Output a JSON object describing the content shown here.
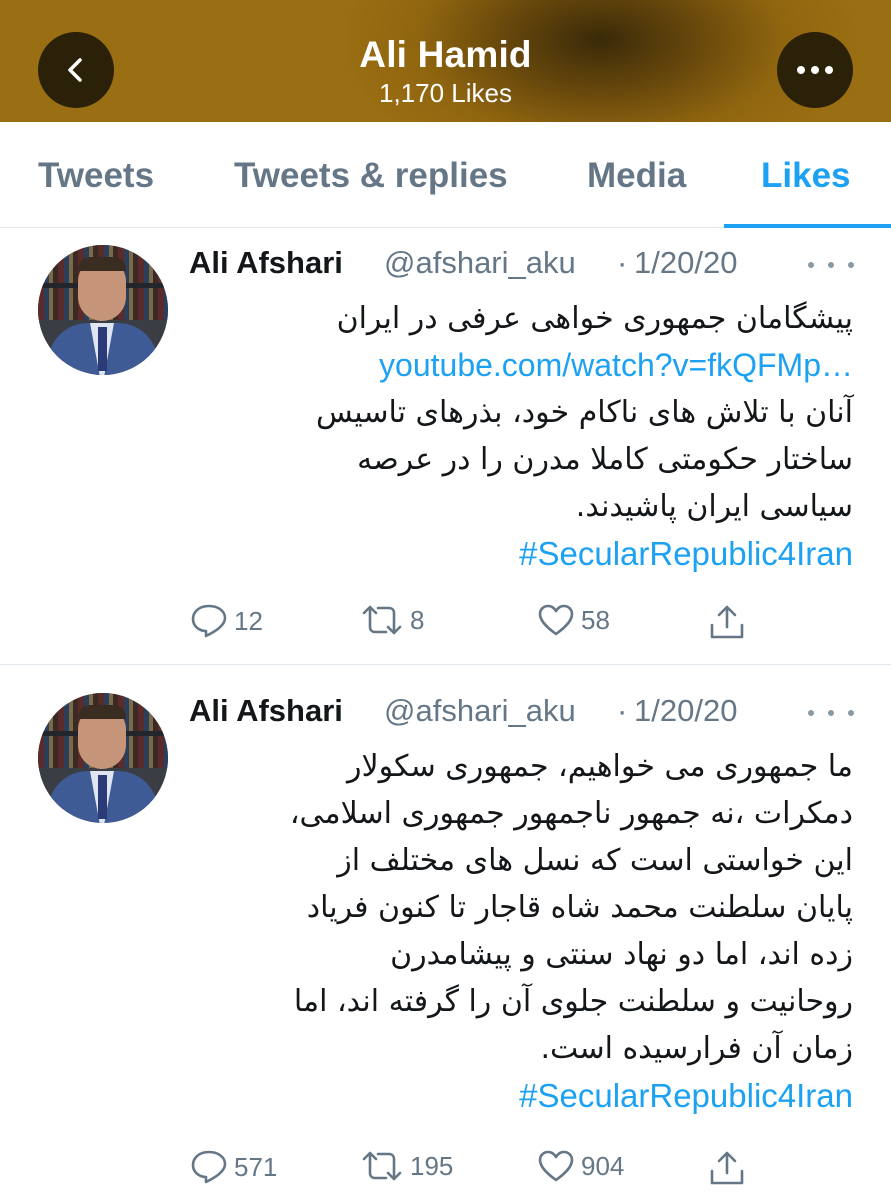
{
  "header": {
    "title": "Ali Hamid",
    "subtitle": "1,170 Likes",
    "bg_color": "#96700f"
  },
  "tabs": [
    {
      "label": "Tweets",
      "active": false
    },
    {
      "label": "Tweets & replies",
      "active": false
    },
    {
      "label": "Media",
      "active": false
    },
    {
      "label": "Likes",
      "active": true
    }
  ],
  "accent_color": "#1da1f2",
  "tweets": [
    {
      "name": "Ali Afshari",
      "handle": "@afshari_aku",
      "sep": "·",
      "date": "1/20/20",
      "lines": [
        "پیشگامان جمهوری خواهی عرفی در ایران"
      ],
      "link": "youtube.com/watch?v=fkQFMp…",
      "lines_after": [
        "آنان با تلاش های ناکام خود، بذرهای تاسیس",
        "ساختار حکومتی کاملا مدرن را در عرصه",
        "سیاسی ایران پاشیدند."
      ],
      "hashtag": "#SecularRepublic4Iran",
      "replies": "12",
      "retweets": "8",
      "likes": "58"
    },
    {
      "name": "Ali Afshari",
      "handle": "@afshari_aku",
      "sep": "·",
      "date": "1/20/20",
      "lines": [
        "ما جمهوری می خواهیم، جمهوری سکولار",
        "دمکرات ،نه جمهور ناجمهور جمهوری اسلامی،",
        "این خواستی است که نسل های مختلف  از",
        "پایان سلطنت محمد شاه قاجار تا کنون فریاد",
        "زده اند، اما دو نهاد سنتی و پیشامدرن",
        "روحانیت و سلطنت جلوی آن را گرفته اند، اما",
        "زمان آن فرارسیده است."
      ],
      "hashtag": "#SecularRepublic4Iran",
      "replies": "571",
      "retweets": "195",
      "likes": "904"
    }
  ]
}
